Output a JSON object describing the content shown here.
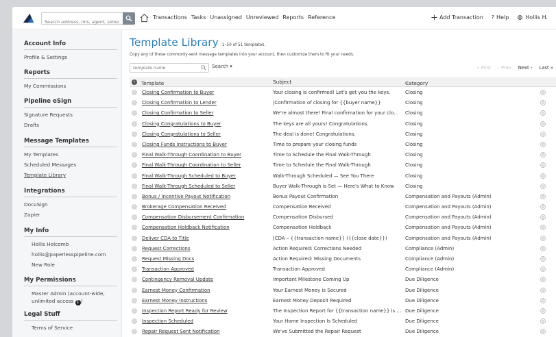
{
  "topbar": {
    "search_placeholder": "Search address, mls, agent, seller,",
    "nav": [
      "Transactions",
      "Tasks",
      "Unassigned",
      "Unreviewed",
      "Reports",
      "Reference"
    ],
    "add_transaction": "Add Transaction",
    "help": "Help",
    "user": "Hollis H."
  },
  "sidebar": {
    "sections": [
      {
        "title": "Account Info",
        "items": [
          "Profile & Settings"
        ]
      },
      {
        "title": "Reports",
        "items": [
          "My Commissions"
        ]
      },
      {
        "title": "Pipeline eSign",
        "items": [
          "Signature Requests",
          "Drafts"
        ]
      },
      {
        "title": "Message Templates",
        "items": [
          "My Templates",
          "Scheduled Messages",
          "Template Library"
        ]
      },
      {
        "title": "Integrations",
        "items": [
          "DocuSign",
          "Zapier"
        ]
      },
      {
        "title": "My Info",
        "items": [
          "Hollis Holcomb",
          "hollis@paperlesspipeline.com",
          "New Role"
        ]
      },
      {
        "title": "My Permissions",
        "items": [
          "Master Admin (account-wide,",
          "unlimited access"
        ]
      },
      {
        "title": "Legal Stuff",
        "items": [
          "Terms of Service"
        ]
      }
    ]
  },
  "main": {
    "title": "Template Library",
    "count": "1–50 of 51 templates.",
    "subtitle": "Copy any of these commonly-sent message templates into your account, then customize them to fit your needs.",
    "filter_placeholder": "template name",
    "search_label": "Search",
    "pager": {
      "first": "« First",
      "prev": "‹ Prev",
      "next": "Next ›",
      "last": "Last »"
    },
    "columns": {
      "template": "Template",
      "subject": "Subject",
      "category": "Category"
    },
    "rows": [
      {
        "name": "Closing Confirmation to Buyer",
        "subject": "Your closing is confirmed! Let's get you the keys.",
        "category": "Closing"
      },
      {
        "name": "Closing Confirmation to Lender",
        "subject": "|Confirmation of closing for {{buyer name}}",
        "category": "Closing"
      },
      {
        "name": "Closing Confirmation to Seller",
        "subject": "We're almost there! Final confirmation for your clo…",
        "category": "Closing"
      },
      {
        "name": "Closing Congratulations to Buyer",
        "subject": "The keys are all yours! Congratulations.",
        "category": "Closing"
      },
      {
        "name": "Closing Congratulations to Seller",
        "subject": "The deal is done! Congratulations.",
        "category": "Closing"
      },
      {
        "name": "Closing Funds Instructions to Buyer",
        "subject": "Time to prepare your closing funds",
        "category": "Closing"
      },
      {
        "name": "Final Walk-Through Coordination to Buyer",
        "subject": "Time to Schedule the Final Walk-Through",
        "category": "Closing"
      },
      {
        "name": "Final Walk-Through Coordination to Seller",
        "subject": "Time to Schedule the Final Walk-Through",
        "category": "Closing"
      },
      {
        "name": "Final Walk-Through Scheduled to Buyer",
        "subject": "Walk-Through Scheduled — See You There",
        "category": "Closing"
      },
      {
        "name": "Final Walk-Through Scheduled to Seller",
        "subject": "Buyer Walk-Through is Set — Here's What to Know",
        "category": "Closing"
      },
      {
        "name": "Bonus / Incentive Payout Notification",
        "subject": "Bonus Payout Confirmation",
        "category": "Compensation and Payouts (Admin)"
      },
      {
        "name": "Brokerage Compensation Received",
        "subject": "Compensation Received",
        "category": "Compensation and Payouts (Admin)"
      },
      {
        "name": "Compensation Disbursement Confirmation",
        "subject": "Compensation Disbursed",
        "category": "Compensation and Payouts (Admin)"
      },
      {
        "name": "Compensation Holdback Notification",
        "subject": "Compensation Holdback",
        "category": "Compensation and Payouts (Admin)"
      },
      {
        "name": "Deliver CDA to Title",
        "subject": "[CDA – {{transaction name}} ({{close date}})",
        "category": "Compensation and Payouts (Admin)"
      },
      {
        "name": "Request Corrections",
        "subject": "Action Required: Corrections Needed",
        "category": "Compliance (Admin)"
      },
      {
        "name": "Request Missing Docs",
        "subject": "Action Required: Missing Documents",
        "category": "Compliance (Admin)"
      },
      {
        "name": "Transaction Approved",
        "subject": "Transaction Approved",
        "category": "Compliance (Admin)"
      },
      {
        "name": "Contingency Removal Update",
        "subject": "Important Milestone Coming Up",
        "category": "Due Diligence"
      },
      {
        "name": "Earnest Money Confirmation",
        "subject": "Your Earnest Money is Secured",
        "category": "Due Diligence"
      },
      {
        "name": "Earnest Money Instructions",
        "subject": "Earnest Money Deposit Required",
        "category": "Due Diligence"
      },
      {
        "name": "Inspection Report Ready for Review",
        "subject": "The Inspection Report for {{transaction name}} is …",
        "category": "Due Diligence"
      },
      {
        "name": "Inspection Scheduled",
        "subject": "Your Home Inspection Is Scheduled",
        "category": "Due Diligence"
      },
      {
        "name": "Repair Request Sent Notification",
        "subject": "We've Submitted the Repair Request",
        "category": "Due Diligence"
      }
    ]
  },
  "colors": {
    "accent": "#2e7fb8",
    "logo_dark": "#1a2a4a",
    "logo_blue": "#2a6fc2"
  }
}
